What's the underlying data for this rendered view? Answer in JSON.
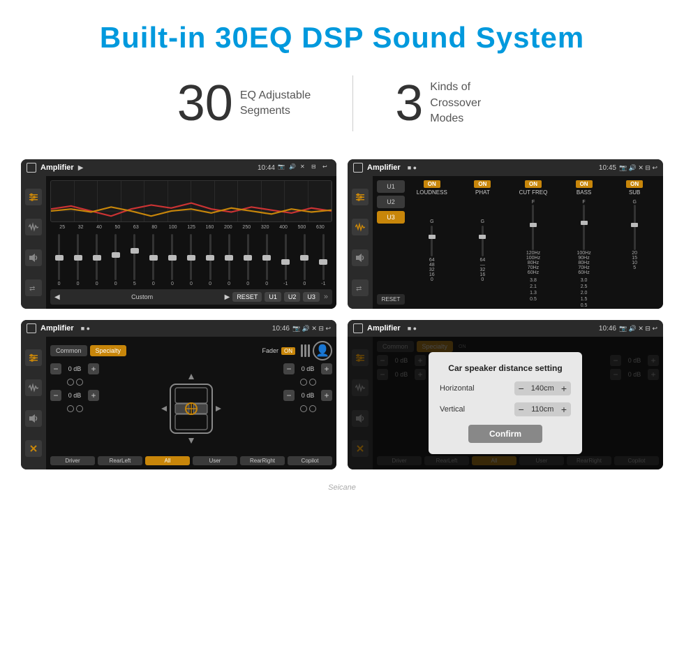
{
  "header": {
    "title": "Built-in 30EQ DSP Sound System"
  },
  "stats": {
    "eq_number": "30",
    "eq_label": "EQ Adjustable\nSegments",
    "crossover_number": "3",
    "crossover_label": "Kinds of\nCrossover Modes"
  },
  "screen1": {
    "title": "Amplifier",
    "time": "10:44",
    "freq_labels": [
      "25",
      "32",
      "40",
      "50",
      "63",
      "80",
      "100",
      "125",
      "160",
      "200",
      "250",
      "320",
      "400",
      "500",
      "630"
    ],
    "slider_values": [
      "0",
      "0",
      "0",
      "0",
      "5",
      "0",
      "0",
      "0",
      "0",
      "0",
      "0",
      "0",
      "-1",
      "0",
      "-1"
    ],
    "mode_label": "Custom",
    "buttons": [
      "RESET",
      "U1",
      "U2",
      "U3"
    ]
  },
  "screen2": {
    "title": "Amplifier",
    "time": "10:45",
    "presets": [
      "U1",
      "U2",
      "U3"
    ],
    "channels": [
      {
        "name": "LOUDNESS",
        "on": true
      },
      {
        "name": "PHAT",
        "on": true
      },
      {
        "name": "CUT FREQ",
        "on": true
      },
      {
        "name": "BASS",
        "on": true
      },
      {
        "name": "SUB",
        "on": true
      }
    ],
    "reset_label": "RESET"
  },
  "screen3": {
    "title": "Amplifier",
    "time": "10:46",
    "modes": [
      "Common",
      "Specialty"
    ],
    "fader_label": "Fader",
    "fader_on": "ON",
    "levels": {
      "front_left": "0 dB",
      "rear_left": "0 dB",
      "front_right": "0 dB",
      "rear_right": "0 dB"
    },
    "zones": [
      "Driver",
      "RearLeft",
      "All",
      "User",
      "RearRight",
      "Copilot"
    ]
  },
  "screen4": {
    "title": "Amplifier",
    "time": "10:46",
    "modes": [
      "Common",
      "Specialty"
    ],
    "dialog": {
      "title": "Car speaker distance setting",
      "horizontal_label": "Horizontal",
      "horizontal_value": "140cm",
      "vertical_label": "Vertical",
      "vertical_value": "110cm",
      "confirm_label": "Confirm"
    },
    "levels": {
      "right": "0 dB",
      "right2": "0 dB"
    },
    "zones": [
      "Driver",
      "RearLeft",
      "All",
      "User",
      "RearRight",
      "Copilot"
    ]
  },
  "watermark": "Seicane"
}
